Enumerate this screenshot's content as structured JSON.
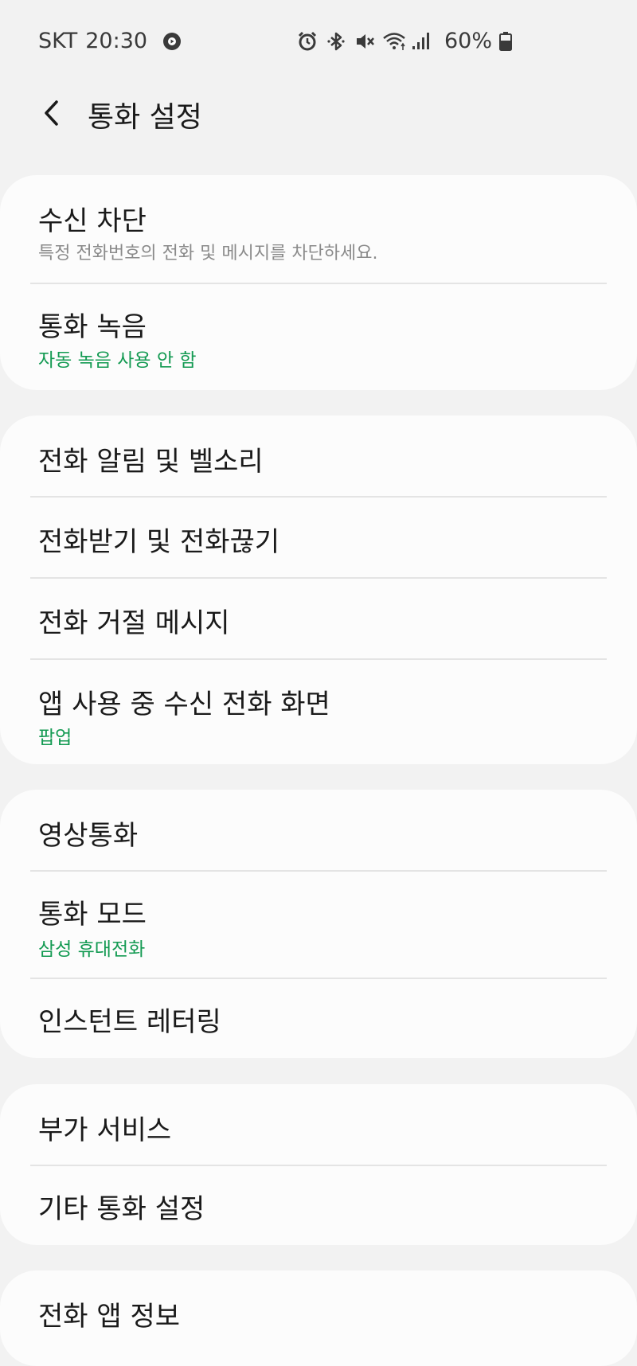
{
  "status_bar": {
    "carrier": "SKT",
    "time": "20:30",
    "battery": "60%"
  },
  "header": {
    "title": "통화 설정"
  },
  "groups": [
    {
      "items": [
        {
          "title": "수신 차단",
          "subtitle": "특정 전화번호의 전화 및 메시지를 차단하세요."
        },
        {
          "title": "통화 녹음",
          "subtitle": "자동 녹음 사용 안 함"
        }
      ]
    },
    {
      "items": [
        {
          "title": "전화 알림 및 벨소리"
        },
        {
          "title": "전화받기 및 전화끊기"
        },
        {
          "title": "전화 거절 메시지"
        },
        {
          "title": "앱 사용 중 수신 전화 화면",
          "subtitle": "팝업"
        }
      ]
    },
    {
      "items": [
        {
          "title": "영상통화"
        },
        {
          "title": "통화 모드",
          "subtitle": "삼성 휴대전화"
        },
        {
          "title": "인스턴트 레터링"
        }
      ]
    },
    {
      "items": [
        {
          "title": "부가 서비스"
        },
        {
          "title": "기타 통화 설정"
        }
      ]
    },
    {
      "items": [
        {
          "title": "전화 앱 정보"
        }
      ]
    }
  ],
  "colors": {
    "background": "#f2f2f2",
    "card": "#fcfcfc",
    "accent_green": "#139a52",
    "subtitle_gray": "#8a8a8a"
  },
  "icons": [
    "play-circle-icon",
    "alarm-icon",
    "bluetooth-icon",
    "mute-icon",
    "wifi-icon",
    "signal-icon",
    "battery-icon",
    "back-arrow-icon"
  ]
}
